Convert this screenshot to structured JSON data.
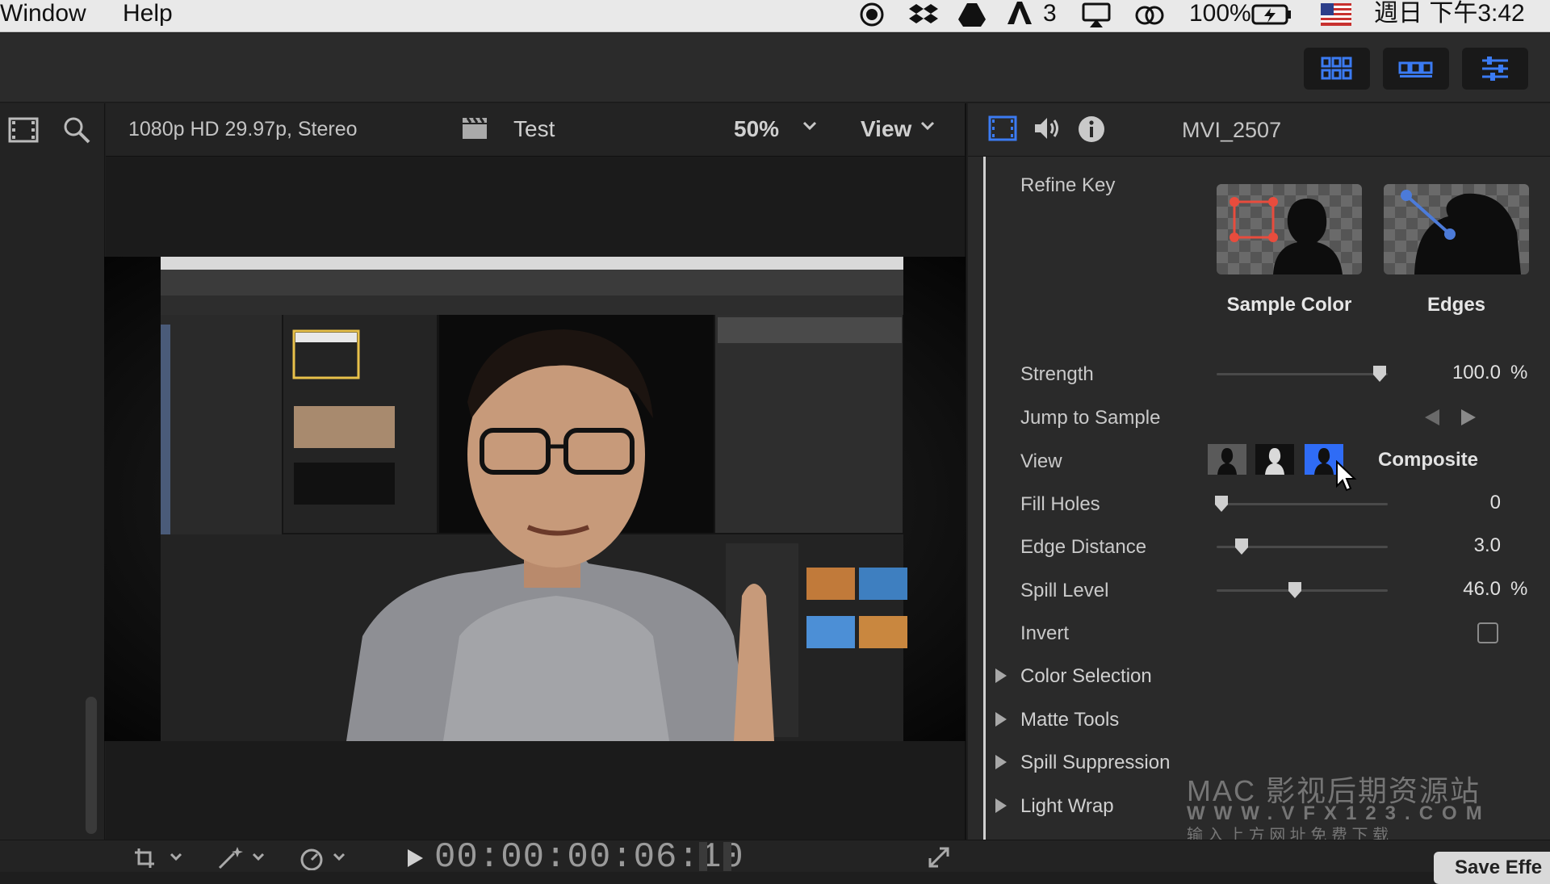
{
  "menubar": {
    "items": [
      "Window",
      "Help"
    ],
    "status": {
      "badge": "3",
      "battery": "100%",
      "datetime": "週日 下午3:42"
    }
  },
  "viewer": {
    "format": "1080p HD 29.97p, Stereo",
    "project": "Test",
    "zoom": "50%",
    "view_label": "View"
  },
  "inspector": {
    "clip_name": "MVI_2507",
    "refine_key_label": "Refine Key",
    "sample_color_label": "Sample Color",
    "edges_label": "Edges",
    "strength": {
      "label": "Strength",
      "value": "100.0",
      "unit": "%",
      "level": 1.0
    },
    "jump_to_sample_label": "Jump to Sample",
    "view": {
      "label": "View",
      "mode": "Composite"
    },
    "fill_holes": {
      "label": "Fill Holes",
      "value": "0",
      "level": 0.0
    },
    "edge_distance": {
      "label": "Edge Distance",
      "value": "3.0",
      "level": 0.15
    },
    "spill_level": {
      "label": "Spill Level",
      "value": "46.0",
      "unit": "%",
      "level": 0.46
    },
    "invert": {
      "label": "Invert",
      "checked": false
    },
    "sections": [
      "Color Selection",
      "Matte Tools",
      "Spill Suppression",
      "Light Wrap"
    ],
    "save_button": "Save Effe"
  },
  "timecode": "00:00:00:06:10",
  "watermark": {
    "line1": "MAC 影视后期资源站",
    "line2": "WWW.VFX123.COM",
    "line3": "输 入 上 方 网 址 免 费 下 载"
  },
  "colors": {
    "accent_blue": "#2f6cf6",
    "key_red": "#e84c3d",
    "handle_blue": "#4c7bd9"
  }
}
